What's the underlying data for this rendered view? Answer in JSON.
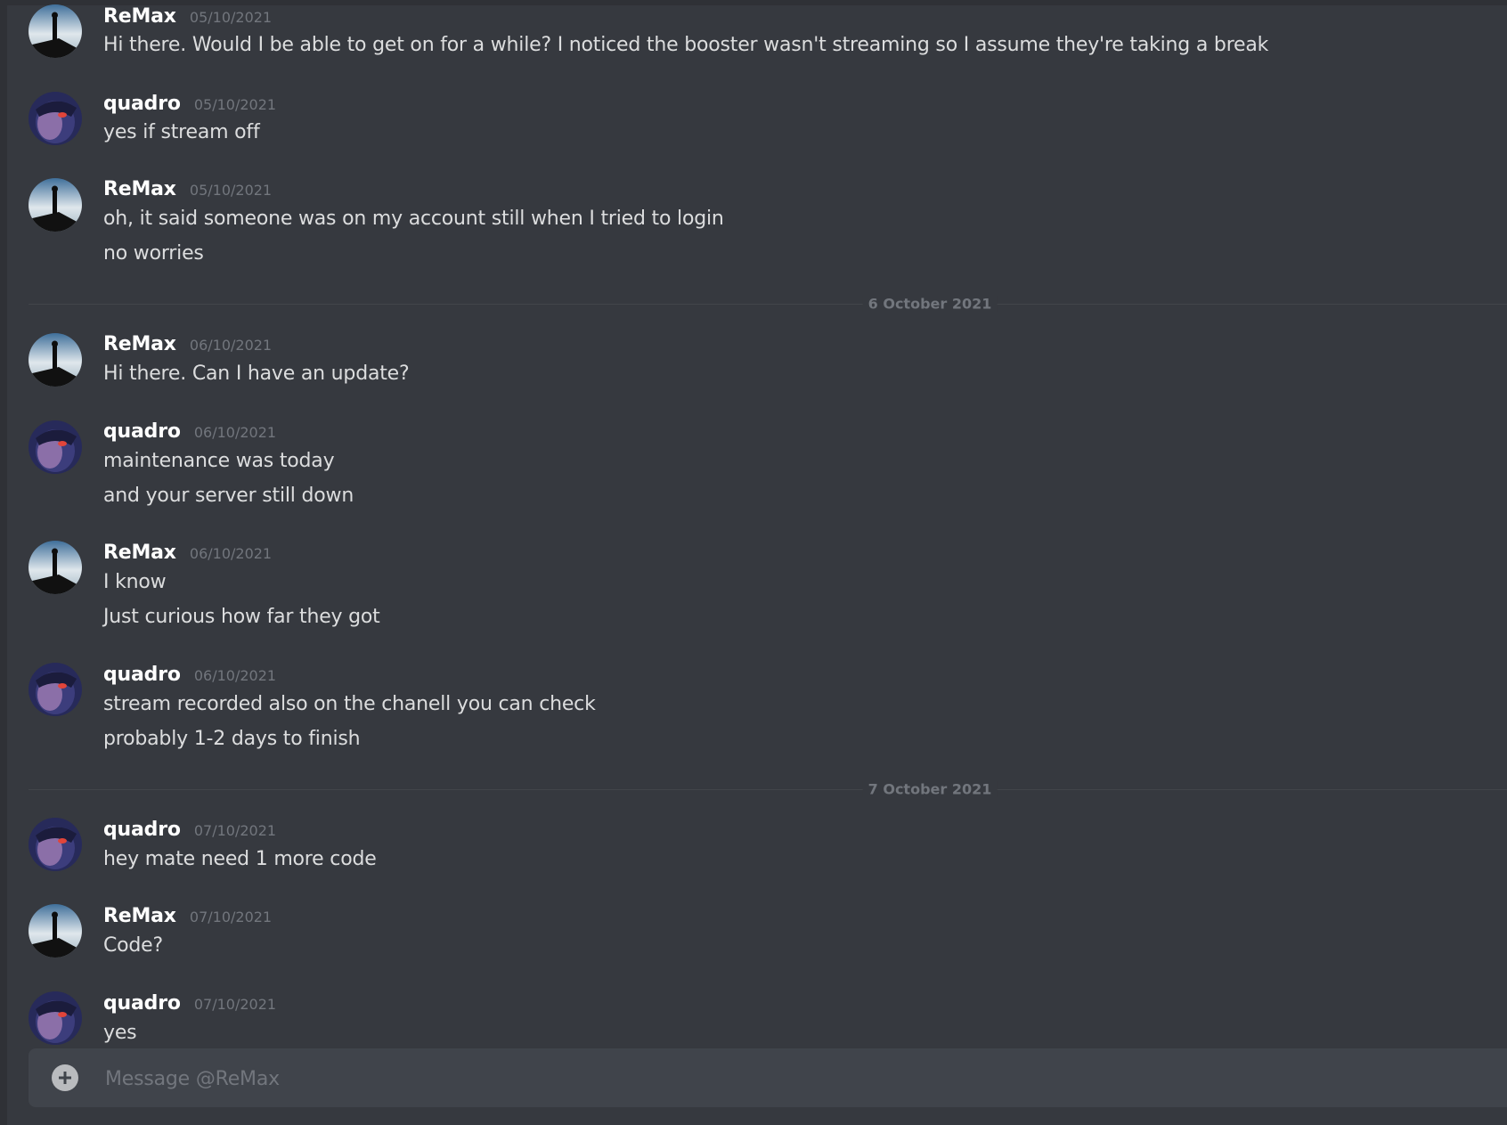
{
  "conversation": {
    "groups": [
      {
        "author": "ReMax",
        "timestamp": "05/10/2021",
        "lines": [
          "Hi there. Would I be able to get on for a while? I noticed the booster wasn't streaming so I assume they're taking a break"
        ]
      },
      {
        "author": "quadro",
        "timestamp": "05/10/2021",
        "lines": [
          "yes if stream off"
        ]
      },
      {
        "author": "ReMax",
        "timestamp": "05/10/2021",
        "lines": [
          "oh, it said someone was on my account still when I tried to login",
          "no worries"
        ]
      },
      {
        "author": "ReMax",
        "timestamp": "06/10/2021",
        "lines": [
          "Hi there. Can I have an update?"
        ]
      },
      {
        "author": "quadro",
        "timestamp": "06/10/2021",
        "lines": [
          "maintenance was today",
          "and your server still down"
        ]
      },
      {
        "author": "ReMax",
        "timestamp": "06/10/2021",
        "lines": [
          "I know",
          "Just curious how far they got"
        ]
      },
      {
        "author": "quadro",
        "timestamp": "06/10/2021",
        "lines": [
          "stream recorded also on the chanell you can check",
          "probably 1-2 days to finish"
        ]
      },
      {
        "author": "quadro",
        "timestamp": "07/10/2021",
        "lines": [
          "hey mate need 1 more code"
        ]
      },
      {
        "author": "ReMax",
        "timestamp": "07/10/2021",
        "lines": [
          "Code?"
        ]
      },
      {
        "author": "quadro",
        "timestamp": "07/10/2021",
        "lines": [
          "yes"
        ]
      }
    ],
    "dividers": [
      "6 October 2021",
      "7 October 2021"
    ]
  },
  "composer": {
    "placeholder": "Message @ReMax",
    "add_icon": "plus-circle-icon"
  },
  "colors": {
    "background": "#36393f",
    "composer": "#40444b",
    "username": "#ffffff",
    "timestamp": "#72767d",
    "text": "#dcddde"
  }
}
